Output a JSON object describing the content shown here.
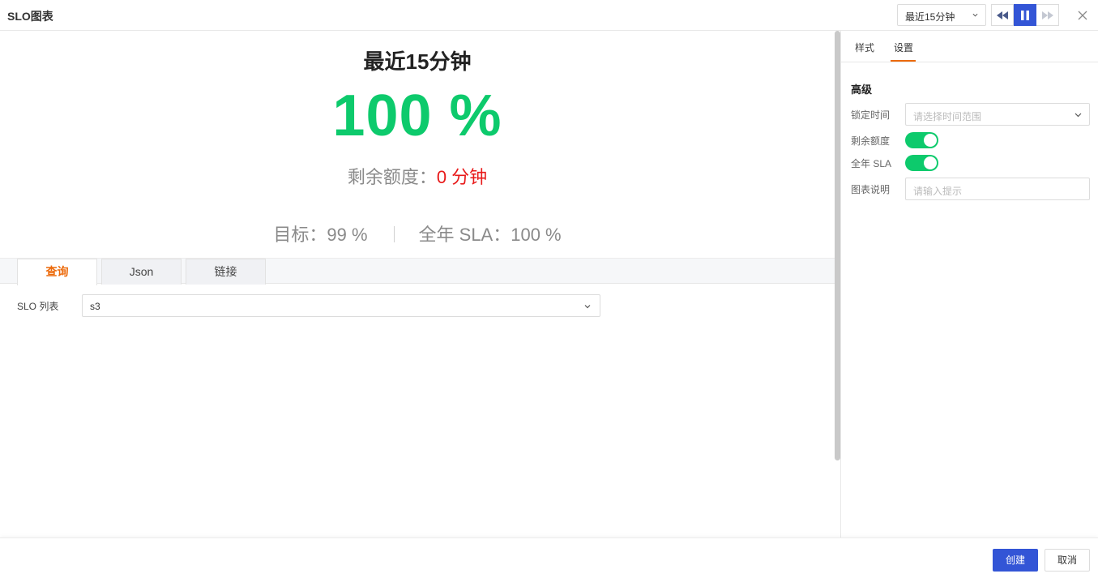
{
  "header": {
    "title": "SLO图表",
    "time_range": "最近15分钟",
    "controls": [
      "backward-icon",
      "pause-icon",
      "forward-icon",
      "close-icon"
    ],
    "accent_color": "#3355d6"
  },
  "preview": {
    "title": "最近15分钟",
    "percent": "100 %",
    "remaining_label": "剩余额度：",
    "remaining_value": "0 分钟",
    "target": "目标：99 %",
    "annual_sla": "全年 SLA：100 %",
    "percent_color": "#0dca6c",
    "remaining_color": "#e81a1a"
  },
  "query_tabs": [
    {
      "label": "查询",
      "active": true
    },
    {
      "label": "Json",
      "active": false
    },
    {
      "label": "链接",
      "active": false
    }
  ],
  "query": {
    "slo_label": "SLO 列表",
    "slo_value": "s3"
  },
  "settings": {
    "tabs": [
      {
        "label": "样式",
        "active": false
      },
      {
        "label": "设置",
        "active": true
      }
    ],
    "section_title": "高级",
    "lock_time_label": "锁定时间",
    "lock_time_placeholder": "请选择时间范围",
    "remaining_toggle_label": "剩余额度",
    "remaining_toggle_on": true,
    "annual_sla_toggle_label": "全年 SLA",
    "annual_sla_toggle_on": true,
    "description_label": "图表说明",
    "description_placeholder": "请输入提示"
  },
  "footer": {
    "create_label": "创建",
    "cancel_label": "取消"
  }
}
